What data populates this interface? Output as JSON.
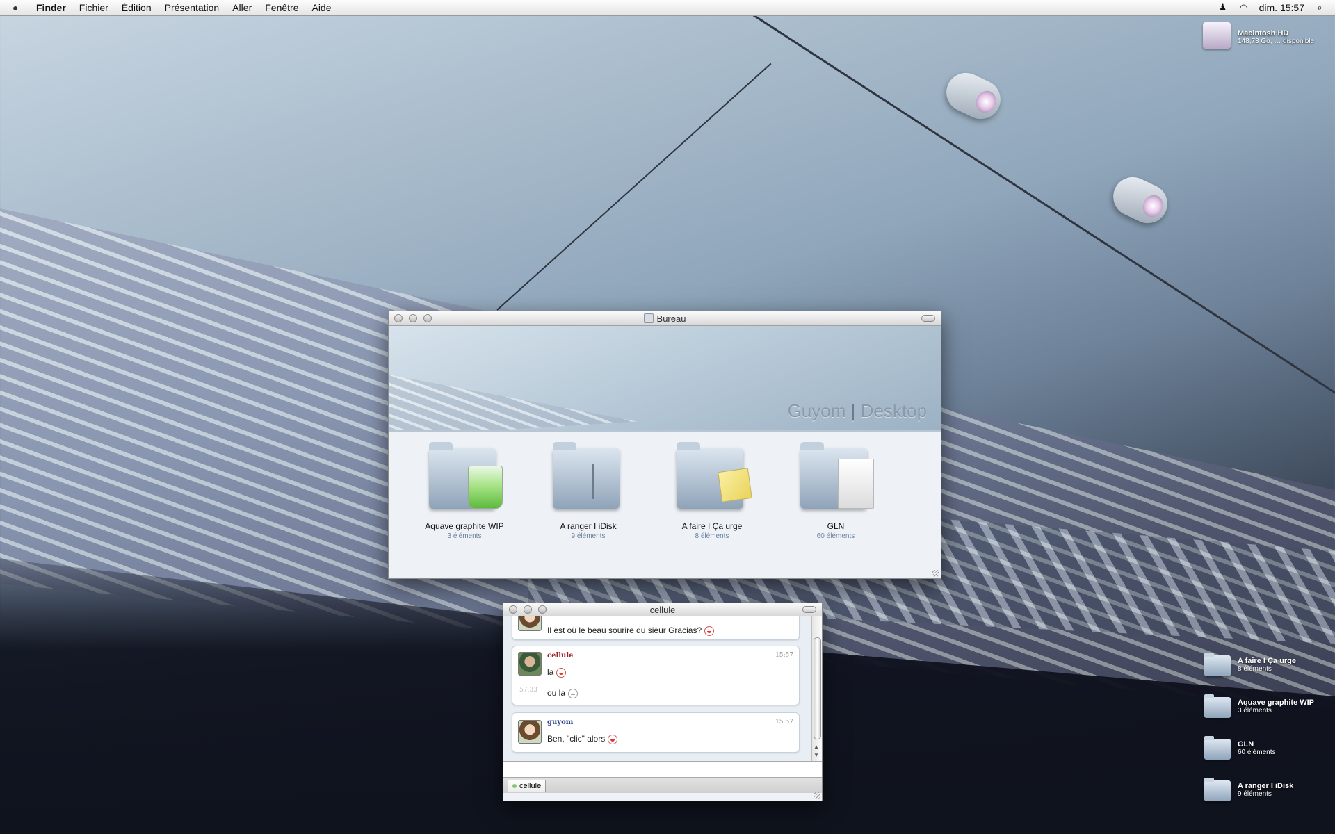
{
  "menubar": {
    "app": "Finder",
    "items": [
      "Fichier",
      "Édition",
      "Présentation",
      "Aller",
      "Fenêtre",
      "Aide"
    ],
    "clock": "dim. 15:57"
  },
  "desktop": {
    "hd": {
      "name": "Macintosh HD",
      "sub": "148,73 Go, … disponible"
    },
    "icons": [
      {
        "name": "A faire I Ça urge",
        "count": "8 éléments"
      },
      {
        "name": "Aquave graphite WIP",
        "count": "3 éléments"
      },
      {
        "name": "GLN",
        "count": "60 éléments"
      },
      {
        "name": "A ranger I iDisk",
        "count": "9 éléments"
      }
    ]
  },
  "finder_window": {
    "title": "Bureau",
    "banner_left": "Guyom",
    "banner_sep": "|",
    "banner_right": "Desktop",
    "items": [
      {
        "name": "Aquave graphite WIP",
        "count": "3 éléments"
      },
      {
        "name": "A ranger I iDisk",
        "count": "9 éléments"
      },
      {
        "name": "A faire I Ça urge",
        "count": "8 éléments"
      },
      {
        "name": "GLN",
        "count": "60 éléments"
      }
    ]
  },
  "chat_window": {
    "title": "cellule",
    "messages": [
      {
        "text": "Il est où le beau sourire du sieur Gracias?"
      },
      {
        "user": "cellule",
        "time": "15:57",
        "lines": [
          "la",
          "ou la"
        ],
        "side_time": "57:33"
      },
      {
        "user": "guyom",
        "time": "15:57",
        "lines": [
          "Ben, \"clic\" alors"
        ]
      }
    ],
    "tab_label": "cellule"
  }
}
